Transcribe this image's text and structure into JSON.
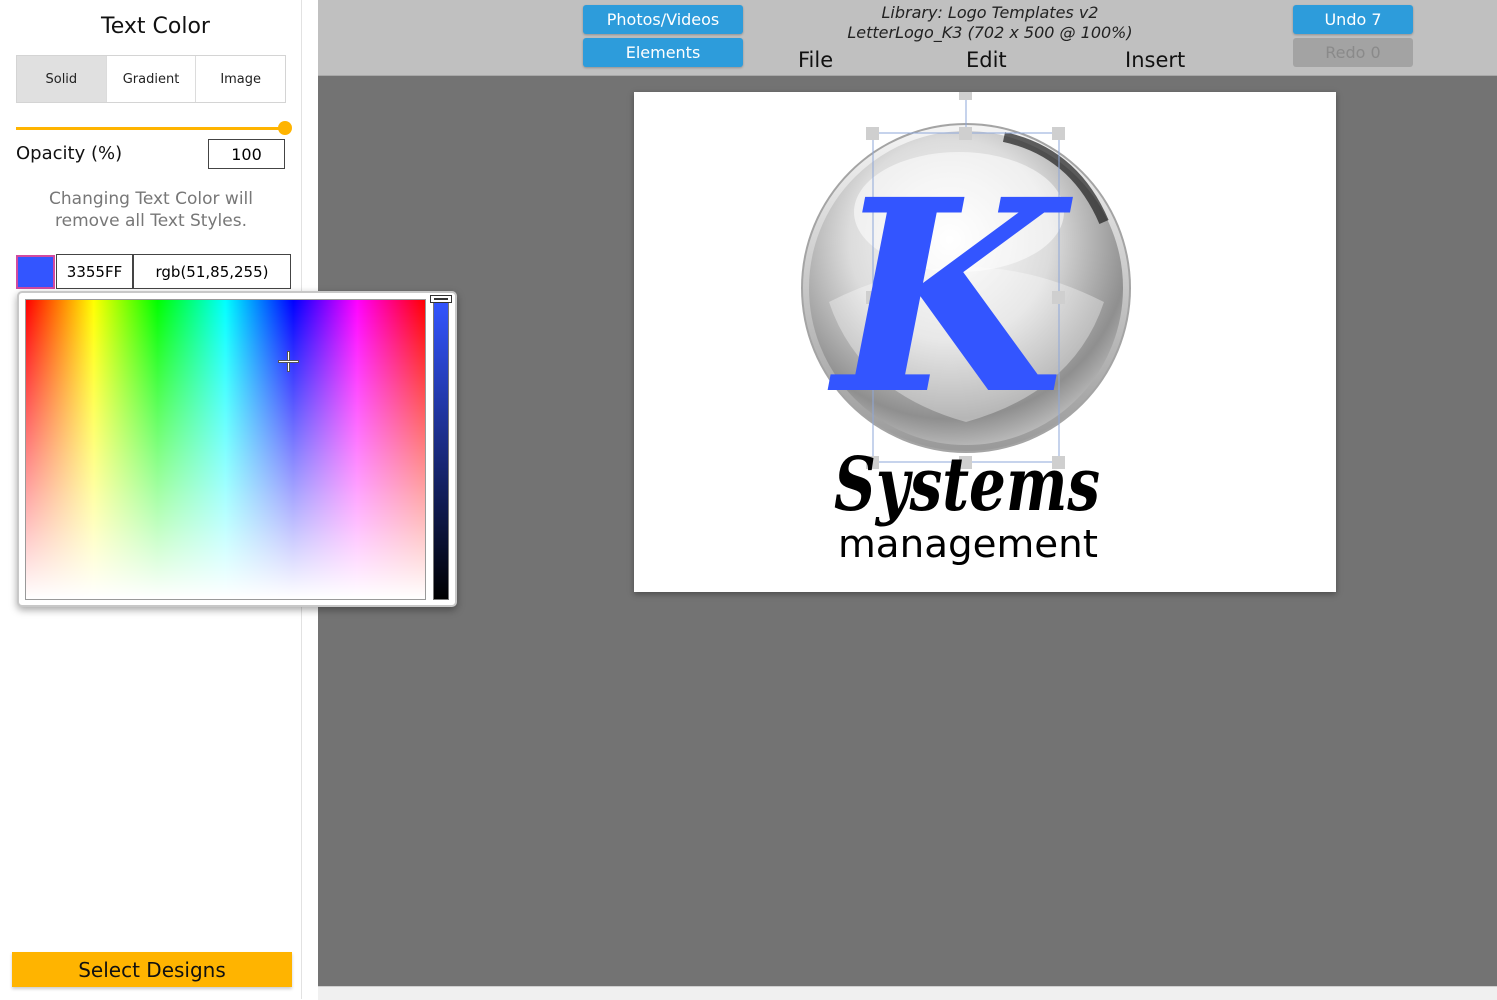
{
  "panel": {
    "title": "Text Color",
    "tabs": [
      {
        "label": "Solid",
        "active": true
      },
      {
        "label": "Gradient",
        "active": false
      },
      {
        "label": "Image",
        "active": false
      }
    ],
    "opacity_label": "Opacity (%)",
    "opacity_value": "100",
    "opacity_fraction": 1.0,
    "warning_line1": "Changing Text Color will",
    "warning_line2": "remove all Text Styles.",
    "current_color": "#3355ff",
    "hex_value": "3355FF",
    "rgb_value": "rgb(51,85,255)",
    "select_designs_label": "Select Designs"
  },
  "toolbar": {
    "photos_videos_label": "Photos/Videos",
    "elements_label": "Elements",
    "library_line1": "Library: Logo Templates v2",
    "library_line2": "LetterLogo_K3 (702 x 500 @ 100%)",
    "menus": [
      "File",
      "Edit",
      "Insert"
    ],
    "undo_label": "Undo 7",
    "redo_label": "Redo 0"
  },
  "canvas": {
    "letter": "K",
    "headline": "Systems",
    "subline": "management"
  },
  "colors": {
    "accent_yellow": "#ffb400",
    "button_blue": "#2d9cdb",
    "workspace_gray": "#737373",
    "letter_blue": "#3355ff"
  },
  "icons": {
    "picker_cursor": "crosshair-icon",
    "value_handle": "slider-handle-icon"
  }
}
